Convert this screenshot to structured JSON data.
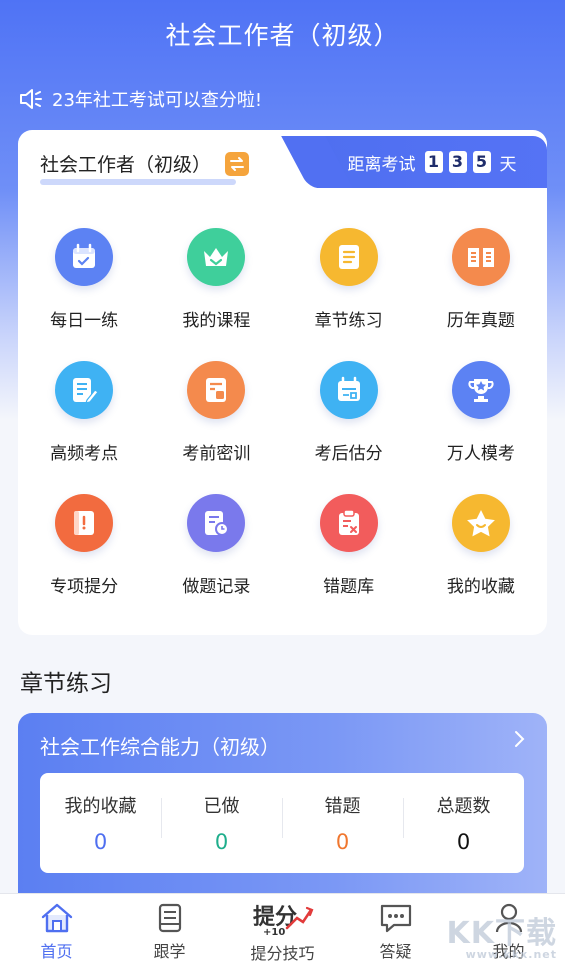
{
  "header": {
    "title": "社会工作者（初级）"
  },
  "notice": {
    "text": "23年社工考试可以查分啦!"
  },
  "card": {
    "subject": "社会工作者（初级）",
    "countdown": {
      "label": "距离考试",
      "digits": [
        "1",
        "3",
        "5"
      ],
      "unit": "天"
    }
  },
  "features": [
    {
      "label": "每日一练",
      "icon": "calendar-check-icon",
      "color": "#5c82f3"
    },
    {
      "label": "我的课程",
      "icon": "crown-icon",
      "color": "#3fcf9b"
    },
    {
      "label": "章节练习",
      "icon": "list-doc-icon",
      "color": "#f6b830"
    },
    {
      "label": "历年真题",
      "icon": "open-book-icon",
      "color": "#f48a4d"
    },
    {
      "label": "高频考点",
      "icon": "edit-doc-icon",
      "color": "#3fb2f3"
    },
    {
      "label": "考前密训",
      "icon": "training-doc-icon",
      "color": "#f48a4d"
    },
    {
      "label": "考后估分",
      "icon": "estimate-calendar-icon",
      "color": "#3fb2f3"
    },
    {
      "label": "万人模考",
      "icon": "trophy-icon",
      "color": "#5c82f3"
    },
    {
      "label": "专项提分",
      "icon": "notebook-icon",
      "color": "#f26b3f"
    },
    {
      "label": "做题记录",
      "icon": "record-clock-icon",
      "color": "#7a79ec"
    },
    {
      "label": "错题库",
      "icon": "wrong-clipboard-icon",
      "color": "#f25c5c"
    },
    {
      "label": "我的收藏",
      "icon": "star-face-icon",
      "color": "#f6b830"
    }
  ],
  "chapter_section": {
    "title": "章节练习",
    "card_title": "社会工作综合能力（初级）",
    "stats": [
      {
        "label": "我的收藏",
        "value": "0",
        "color": "#4f6ff0"
      },
      {
        "label": "已做",
        "value": "0",
        "color": "#1fae8c"
      },
      {
        "label": "错题",
        "value": "0",
        "color": "#f0772f"
      },
      {
        "label": "总题数",
        "value": "0",
        "color": "#111111"
      }
    ]
  },
  "tabbar": {
    "tabs": [
      {
        "label": "首页",
        "icon": "home-icon",
        "active": true
      },
      {
        "label": "跟学",
        "icon": "book-icon",
        "active": false
      },
      {
        "label": "提分技巧",
        "icon": "score-boost-icon",
        "active": false
      },
      {
        "label": "答疑",
        "icon": "chat-icon",
        "active": false
      },
      {
        "label": "我的",
        "icon": "user-icon",
        "active": false
      }
    ],
    "boost_logo_text": "提分",
    "boost_logo_sub": "+10"
  },
  "watermark": {
    "text": "KK下载",
    "sub": "www.kkx.net"
  },
  "colors": {
    "primary": "#4f6ff0",
    "background": "#f4f6fb"
  }
}
